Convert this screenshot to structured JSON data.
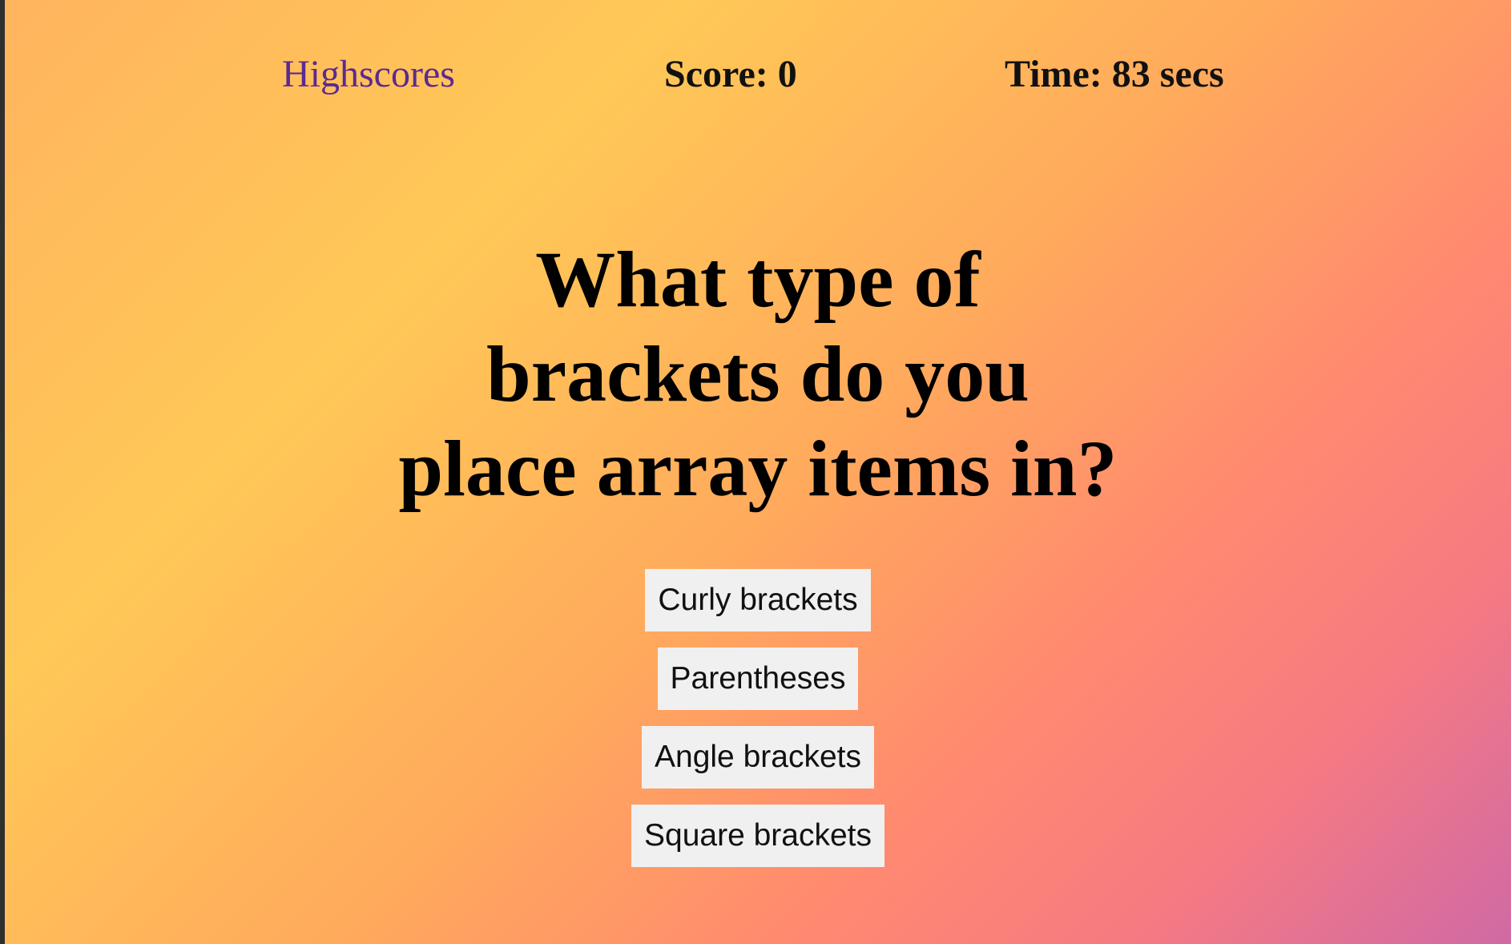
{
  "header": {
    "highscores_label": "Highscores",
    "score_text": "Score: 0",
    "time_text": "Time: 83 secs"
  },
  "question": {
    "lines": [
      "What type of",
      "brackets do you",
      "place array items in?"
    ]
  },
  "answers": [
    "Curly brackets",
    "Parentheses",
    "Angle brackets",
    "Square brackets"
  ],
  "colors": {
    "link": "#5b2a91",
    "button_bg": "#f0f0f0",
    "gradient_start": "#ffb45e",
    "gradient_end": "#d06aa4"
  }
}
